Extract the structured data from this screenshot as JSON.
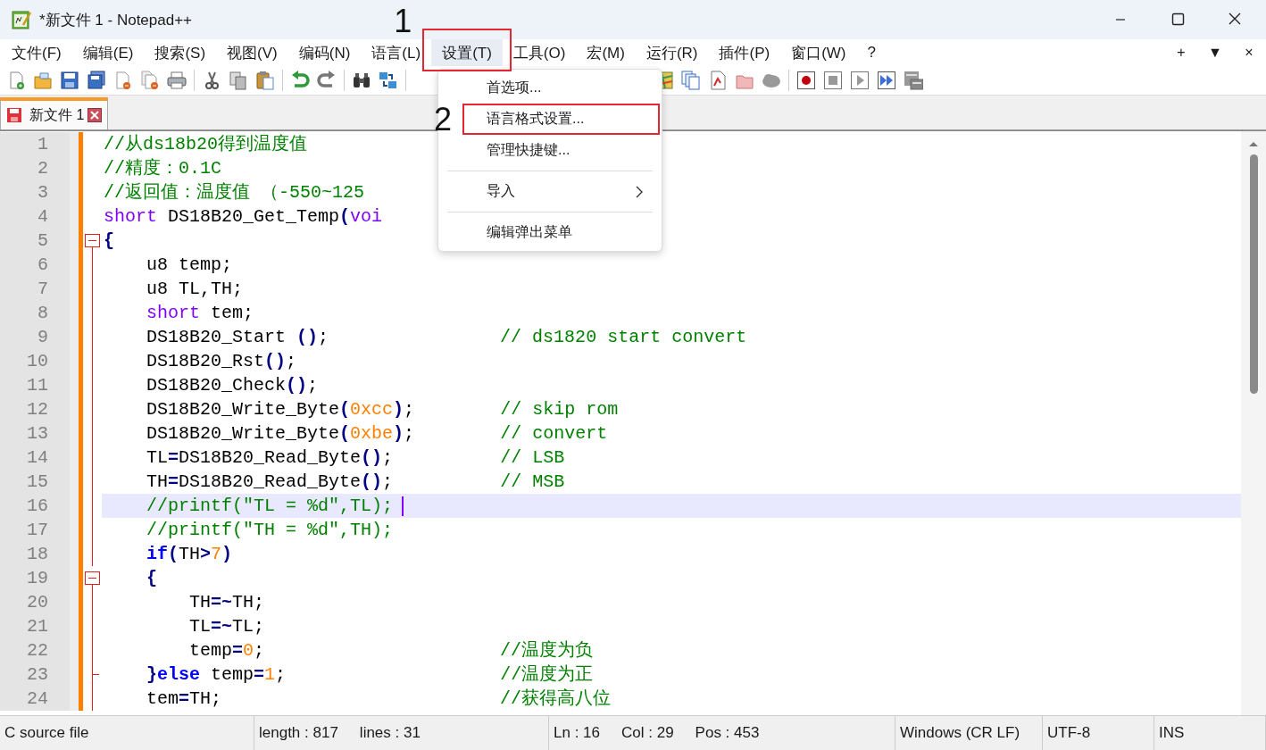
{
  "window": {
    "title": "*新文件 1 - Notepad++"
  },
  "menu_bar": {
    "items": [
      {
        "label": "文件(F)",
        "selected": false
      },
      {
        "label": "编辑(E)",
        "selected": false
      },
      {
        "label": "搜索(S)",
        "selected": false
      },
      {
        "label": "视图(V)",
        "selected": false
      },
      {
        "label": "编码(N)",
        "selected": false
      },
      {
        "label": "语言(L)",
        "selected": false
      },
      {
        "label": "设置(T)",
        "selected": true,
        "annotation": "1"
      },
      {
        "label": "工具(O)",
        "selected": false
      },
      {
        "label": "宏(M)",
        "selected": false
      },
      {
        "label": "运行(R)",
        "selected": false
      },
      {
        "label": "插件(P)",
        "selected": false
      },
      {
        "label": "窗口(W)",
        "selected": false
      },
      {
        "label": "?",
        "selected": false
      }
    ],
    "right_controls": [
      "+",
      "▼",
      "×"
    ]
  },
  "dropdown": {
    "items": [
      {
        "kind": "item",
        "label": "首选项..."
      },
      {
        "kind": "item",
        "label": "语言格式设置...",
        "annotation": "2"
      },
      {
        "kind": "item",
        "label": "管理快捷键..."
      },
      {
        "kind": "separator"
      },
      {
        "kind": "submenu",
        "label": "导入"
      },
      {
        "kind": "separator"
      },
      {
        "kind": "item",
        "label": "编辑弹出菜单"
      }
    ]
  },
  "tabs": [
    {
      "label": "新文件 1",
      "selected": true
    }
  ],
  "editor": {
    "lines": [
      {
        "number": "1",
        "selected": false,
        "kind": "plain",
        "tokens": [
          {
            "kind": "comment",
            "text": "//从ds18b20得到温度值"
          }
        ]
      },
      {
        "number": "2",
        "selected": false,
        "kind": "plain",
        "tokens": [
          {
            "kind": "comment",
            "text": "//精度：0.1C"
          }
        ]
      },
      {
        "number": "3",
        "selected": false,
        "kind": "plain",
        "tokens": [
          {
            "kind": "comment",
            "text": "//返回值：温度值 （-550~125"
          }
        ]
      },
      {
        "number": "4",
        "selected": false,
        "kind": "plain",
        "tokens": [
          {
            "kind": "type",
            "text": "short"
          },
          {
            "kind": "plain",
            "text": " DS18B20_Get_Temp"
          },
          {
            "kind": "op",
            "text": "("
          },
          {
            "kind": "type",
            "text": "voi"
          }
        ]
      },
      {
        "number": "5",
        "selected": false,
        "kind": "foldstart",
        "tokens": [
          {
            "kind": "op",
            "text": "{"
          }
        ]
      },
      {
        "number": "6",
        "selected": false,
        "kind": "foldbody",
        "tokens": [
          {
            "kind": "plain",
            "text": "    u8 temp;"
          }
        ]
      },
      {
        "number": "7",
        "selected": false,
        "kind": "foldbody",
        "tokens": [
          {
            "kind": "plain",
            "text": "    u8 TL,TH;"
          }
        ]
      },
      {
        "number": "8",
        "selected": false,
        "kind": "foldbody",
        "tokens": [
          {
            "kind": "type",
            "text": "    short"
          },
          {
            "kind": "plain",
            "text": " tem;"
          }
        ]
      },
      {
        "number": "9",
        "selected": false,
        "kind": "foldbody",
        "tokens": [
          {
            "kind": "plain",
            "text": "    DS18B20_Start "
          },
          {
            "kind": "op",
            "text": "()"
          },
          {
            "kind": "plain",
            "text": ";"
          },
          {
            "kind": "comment",
            "text": "                // ds1820 start convert"
          }
        ]
      },
      {
        "number": "10",
        "selected": false,
        "kind": "foldbody",
        "tokens": [
          {
            "kind": "plain",
            "text": "    DS18B20_Rst"
          },
          {
            "kind": "op",
            "text": "()"
          },
          {
            "kind": "plain",
            "text": ";"
          }
        ]
      },
      {
        "number": "11",
        "selected": false,
        "kind": "foldbody",
        "tokens": [
          {
            "kind": "plain",
            "text": "    DS18B20_Check"
          },
          {
            "kind": "op",
            "text": "()"
          },
          {
            "kind": "plain",
            "text": ";"
          }
        ]
      },
      {
        "number": "12",
        "selected": false,
        "kind": "foldbody",
        "tokens": [
          {
            "kind": "plain",
            "text": "    DS18B20_Write_Byte"
          },
          {
            "kind": "op",
            "text": "("
          },
          {
            "kind": "number",
            "text": "0xcc"
          },
          {
            "kind": "op",
            "text": ")"
          },
          {
            "kind": "plain",
            "text": ";"
          },
          {
            "kind": "comment",
            "text": "        // skip rom"
          }
        ]
      },
      {
        "number": "13",
        "selected": false,
        "kind": "foldbody",
        "tokens": [
          {
            "kind": "plain",
            "text": "    DS18B20_Write_Byte"
          },
          {
            "kind": "op",
            "text": "("
          },
          {
            "kind": "number",
            "text": "0xbe"
          },
          {
            "kind": "op",
            "text": ")"
          },
          {
            "kind": "plain",
            "text": ";"
          },
          {
            "kind": "comment",
            "text": "        // convert"
          }
        ]
      },
      {
        "number": "14",
        "selected": false,
        "kind": "foldbody",
        "tokens": [
          {
            "kind": "plain",
            "text": "    TL"
          },
          {
            "kind": "op",
            "text": "="
          },
          {
            "kind": "plain",
            "text": "DS18B20_Read_Byte"
          },
          {
            "kind": "op",
            "text": "()"
          },
          {
            "kind": "plain",
            "text": ";"
          },
          {
            "kind": "comment",
            "text": "          // LSB"
          }
        ]
      },
      {
        "number": "15",
        "selected": false,
        "kind": "foldbody",
        "tokens": [
          {
            "kind": "plain",
            "text": "    TH"
          },
          {
            "kind": "op",
            "text": "="
          },
          {
            "kind": "plain",
            "text": "DS18B20_Read_Byte"
          },
          {
            "kind": "op",
            "text": "()"
          },
          {
            "kind": "plain",
            "text": ";"
          },
          {
            "kind": "comment",
            "text": "          // MSB"
          }
        ]
      },
      {
        "number": "16",
        "selected": true,
        "kind": "foldbody",
        "tokens": [
          {
            "kind": "comment",
            "text": "    //printf(\"TL = %d\",TL);"
          }
        ]
      },
      {
        "number": "17",
        "selected": false,
        "kind": "foldbody",
        "tokens": [
          {
            "kind": "comment",
            "text": "    //printf(\"TH = %d\",TH);"
          }
        ]
      },
      {
        "number": "18",
        "selected": false,
        "kind": "foldbody",
        "tokens": [
          {
            "kind": "keyword",
            "text": "    if"
          },
          {
            "kind": "op",
            "text": "("
          },
          {
            "kind": "plain",
            "text": "TH"
          },
          {
            "kind": "op",
            "text": ">"
          },
          {
            "kind": "number",
            "text": "7"
          },
          {
            "kind": "op",
            "text": ")"
          }
        ]
      },
      {
        "number": "19",
        "selected": false,
        "kind": "foldstart",
        "tokens": [
          {
            "kind": "op",
            "text": "    {"
          }
        ]
      },
      {
        "number": "20",
        "selected": false,
        "kind": "foldbody",
        "tokens": [
          {
            "kind": "plain",
            "text": "        TH"
          },
          {
            "kind": "op",
            "text": "=~"
          },
          {
            "kind": "plain",
            "text": "TH;"
          }
        ]
      },
      {
        "number": "21",
        "selected": false,
        "kind": "foldbody",
        "tokens": [
          {
            "kind": "plain",
            "text": "        TL"
          },
          {
            "kind": "op",
            "text": "=~"
          },
          {
            "kind": "plain",
            "text": "TL;"
          }
        ]
      },
      {
        "number": "22",
        "selected": false,
        "kind": "foldbody",
        "tokens": [
          {
            "kind": "plain",
            "text": "        temp"
          },
          {
            "kind": "op",
            "text": "="
          },
          {
            "kind": "number",
            "text": "0"
          },
          {
            "kind": "plain",
            "text": ";"
          },
          {
            "kind": "comment",
            "text": "                      //温度为负"
          }
        ]
      },
      {
        "number": "23",
        "selected": false,
        "kind": "foldend",
        "tokens": [
          {
            "kind": "op",
            "text": "    }"
          },
          {
            "kind": "keyword",
            "text": "else"
          },
          {
            "kind": "plain",
            "text": " temp"
          },
          {
            "kind": "op",
            "text": "="
          },
          {
            "kind": "number",
            "text": "1"
          },
          {
            "kind": "plain",
            "text": ";"
          },
          {
            "kind": "comment",
            "text": "                    //温度为正"
          }
        ]
      },
      {
        "number": "24",
        "selected": false,
        "kind": "foldbody",
        "tokens": [
          {
            "kind": "plain",
            "text": "    tem"
          },
          {
            "kind": "op",
            "text": "="
          },
          {
            "kind": "plain",
            "text": "TH;"
          },
          {
            "kind": "comment",
            "text": "                          //获得高八位"
          }
        ]
      }
    ]
  },
  "status_bar": {
    "sections": [
      {
        "fields": [
          "C source file"
        ]
      },
      {
        "fields": [
          "length : 817",
          "lines : 31"
        ]
      },
      {
        "fields": [
          "Ln : 16",
          "Col : 29",
          "Pos : 453"
        ]
      },
      {
        "fields": [
          "Windows (CR LF)"
        ]
      },
      {
        "fields": [
          "UTF-8"
        ]
      },
      {
        "fields": [
          "INS"
        ]
      }
    ]
  }
}
